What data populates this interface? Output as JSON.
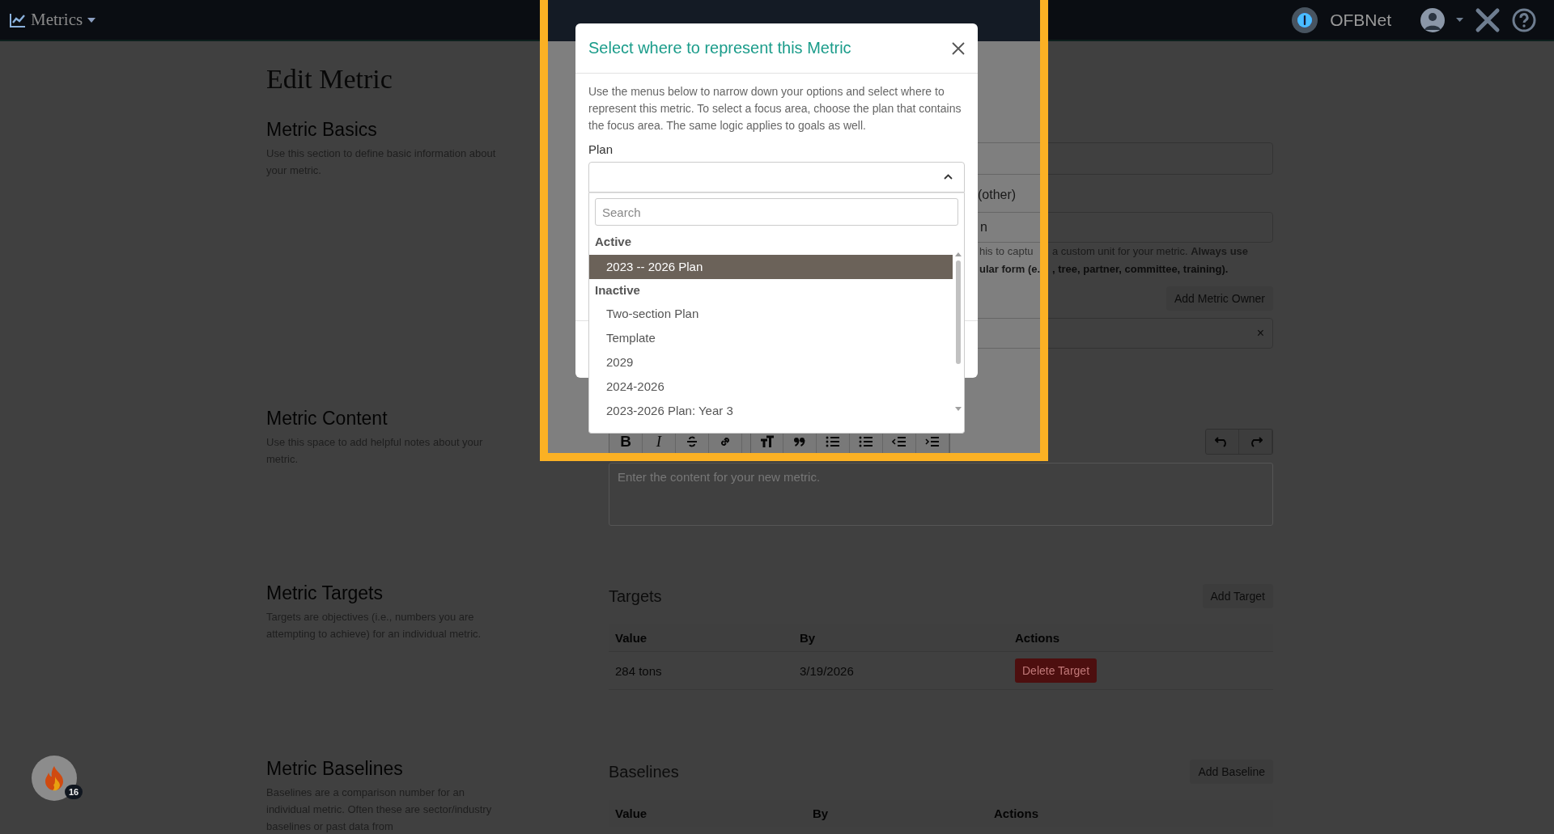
{
  "header": {
    "app_menu": "Metrics",
    "org": "OFBNet"
  },
  "page": {
    "title": "Edit Metric"
  },
  "basics": {
    "heading": "Metric Basics",
    "description": "Use this section to define basic information about your metric.",
    "other_label": "(other)",
    "unit_value": "n",
    "hint_lines": [
      {
        "bold": false,
        "parts": [
          "his to captu",
          "a custom unit for your metric. **Always use**"
        ]
      },
      {
        "bold": true,
        "parts": [
          "ular form (e.",
          ", tree, partner, committee, training)."
        ]
      }
    ],
    "add_owner_button": "Add Metric Owner",
    "owner_clear": "×"
  },
  "content": {
    "heading": "Metric Content",
    "description": "Use this space to add helpful notes about your metric.",
    "toolbar": [
      {
        "kind": "bold",
        "glyph": "B"
      },
      {
        "kind": "italic",
        "glyph": "I"
      },
      {
        "kind": "strike"
      },
      {
        "kind": "link"
      },
      {
        "kind": "heading"
      },
      {
        "kind": "quote"
      },
      {
        "kind": "bullets"
      },
      {
        "kind": "numbers"
      },
      {
        "kind": "outdent"
      },
      {
        "kind": "indent"
      }
    ],
    "placeholder": "Enter the content for your new metric."
  },
  "targets": {
    "heading": "Metric Targets",
    "description": "Targets are objectives (i.e., numbers you are attempting to achieve) for an individual metric.",
    "panel_title": "Targets",
    "add_button": "Add Target",
    "columns": [
      "Value",
      "By",
      "Actions"
    ],
    "rows": [
      {
        "value": "284 tons",
        "by": "3/19/2026",
        "action": "Delete Target"
      }
    ]
  },
  "baselines": {
    "heading": "Metric Baselines",
    "description": "Baselines are a comparison number for an individual metric. Often these are sector/industry baselines or past data from",
    "panel_title": "Baselines",
    "add_button": "Add Baseline",
    "columns": [
      "Value",
      "By",
      "Actions"
    ]
  },
  "notification": {
    "count": "16"
  },
  "modal": {
    "title": "Select where to represent this Metric",
    "description": "Use the menus below to narrow down your options and select where to represent this metric. To select a focus area, choose the plan that contains the focus area. The same logic applies to goals as well.",
    "plan_label": "Plan",
    "search_placeholder": "Search",
    "groups": [
      {
        "label": "Active",
        "options": [
          {
            "label": "2023 -- 2026 Plan",
            "selected": true
          }
        ]
      },
      {
        "label": "Inactive",
        "options": [
          {
            "label": "Two-section Plan",
            "selected": false
          },
          {
            "label": "Template",
            "selected": false
          },
          {
            "label": "2029",
            "selected": false
          },
          {
            "label": "2024-2026",
            "selected": false
          },
          {
            "label": "2023-2026 Plan: Year 3",
            "selected": false
          }
        ]
      }
    ]
  }
}
